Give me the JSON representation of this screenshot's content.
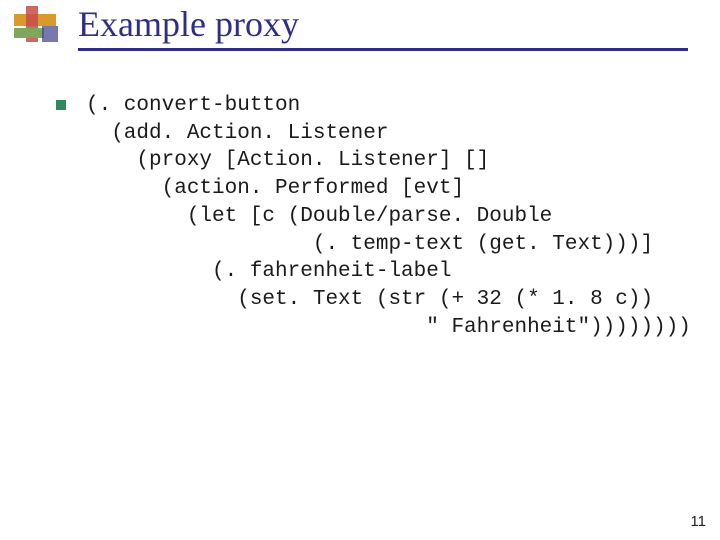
{
  "slide": {
    "title": "Example proxy",
    "page_number": "11"
  },
  "code": {
    "lines": [
      "(. convert-button",
      "  (add. Action. Listener",
      "    (proxy [Action. Listener] []",
      "      (action. Performed [evt]",
      "        (let [c (Double/parse. Double",
      "                  (. temp-text (get. Text)))]",
      "          (. fahrenheit-label",
      "            (set. Text (str (+ 32 (* 1. 8 c))",
      "                           \" Fahrenheit\"))))))))"
    ]
  }
}
